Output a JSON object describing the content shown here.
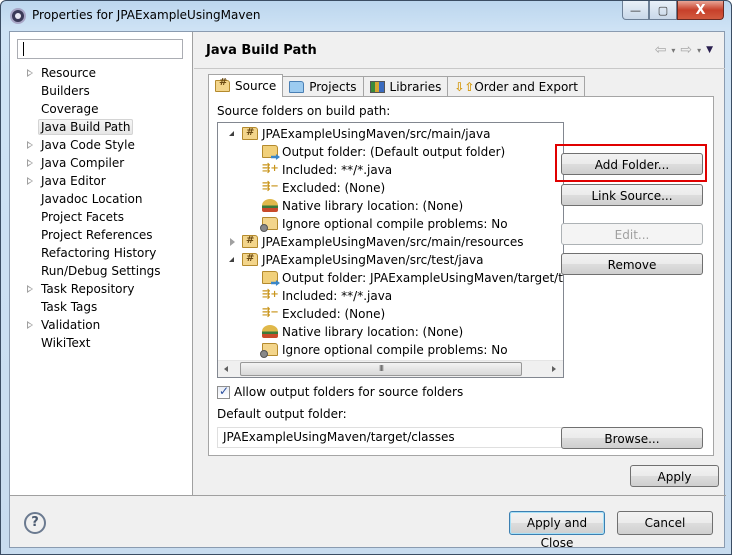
{
  "window": {
    "title": "Properties for JPAExampleUsingMaven",
    "controls": {
      "minimize": "—",
      "maximize": "▢",
      "close": "X"
    }
  },
  "sidebar": {
    "filter_value": "",
    "items": [
      {
        "label": "Resource",
        "expandable": true
      },
      {
        "label": "Builders",
        "expandable": false
      },
      {
        "label": "Coverage",
        "expandable": false
      },
      {
        "label": "Java Build Path",
        "expandable": false,
        "selected": true
      },
      {
        "label": "Java Code Style",
        "expandable": true
      },
      {
        "label": "Java Compiler",
        "expandable": true
      },
      {
        "label": "Java Editor",
        "expandable": true
      },
      {
        "label": "Javadoc Location",
        "expandable": false
      },
      {
        "label": "Project Facets",
        "expandable": false
      },
      {
        "label": "Project References",
        "expandable": false
      },
      {
        "label": "Refactoring History",
        "expandable": false
      },
      {
        "label": "Run/Debug Settings",
        "expandable": false
      },
      {
        "label": "Task Repository",
        "expandable": true
      },
      {
        "label": "Task Tags",
        "expandable": false
      },
      {
        "label": "Validation",
        "expandable": true
      },
      {
        "label": "WikiText",
        "expandable": false
      }
    ]
  },
  "header": {
    "title": "Java Build Path",
    "nav": {
      "back": "⇦",
      "forward": "⇨",
      "dropdown": "▾",
      "menu": "▼"
    }
  },
  "tabs": [
    {
      "label": "Source",
      "icon": "package-folder-icon",
      "active": true
    },
    {
      "label": "Projects",
      "icon": "project-folder-icon",
      "active": false
    },
    {
      "label": "Libraries",
      "icon": "libraries-icon",
      "active": false
    },
    {
      "label": "Order and Export",
      "icon": "order-export-icon",
      "active": false
    }
  ],
  "source_tab": {
    "section_label": "Source folders on build path:",
    "tree": [
      {
        "label": "JPAExampleUsingMaven/src/main/java",
        "level": 0,
        "state": "expanded",
        "icon": "package-folder"
      },
      {
        "label": "Output folder: (Default output folder)",
        "level": 1,
        "icon": "output-folder"
      },
      {
        "label": "Included: **/*.java",
        "level": 1,
        "icon": "included"
      },
      {
        "label": "Excluded: (None)",
        "level": 1,
        "icon": "excluded"
      },
      {
        "label": "Native library location: (None)",
        "level": 1,
        "icon": "native-library"
      },
      {
        "label": "Ignore optional compile problems: No",
        "level": 1,
        "icon": "ignore-problems"
      },
      {
        "label": "JPAExampleUsingMaven/src/main/resources",
        "level": 0,
        "state": "collapsed",
        "icon": "package-folder"
      },
      {
        "label": "JPAExampleUsingMaven/src/test/java",
        "level": 0,
        "state": "expanded",
        "icon": "package-folder"
      },
      {
        "label": "Output folder: JPAExampleUsingMaven/target/test-cl",
        "level": 1,
        "icon": "output-folder"
      },
      {
        "label": "Included: **/*.java",
        "level": 1,
        "icon": "included"
      },
      {
        "label": "Excluded: (None)",
        "level": 1,
        "icon": "excluded"
      },
      {
        "label": "Native library location: (None)",
        "level": 1,
        "icon": "native-library"
      },
      {
        "label": "Ignore optional compile problems: No",
        "level": 1,
        "icon": "ignore-problems"
      }
    ],
    "scroll_thumb_grip": "III",
    "buttons": {
      "add_folder": "Add Folder...",
      "link_source": "Link Source...",
      "edit": "Edit...",
      "remove": "Remove",
      "browse": "Browse..."
    },
    "allow_output_folders": {
      "label": "Allow output folders for source folders",
      "checked": true
    },
    "default_output_label": "Default output folder:",
    "default_output_value": "JPAExampleUsingMaven/target/classes"
  },
  "footer": {
    "apply": "Apply",
    "apply_and_close": "Apply and Close",
    "cancel": "Cancel",
    "help": "?"
  },
  "colors": {
    "highlight": "#e00000",
    "default_button_border": "#3c7fb1"
  }
}
